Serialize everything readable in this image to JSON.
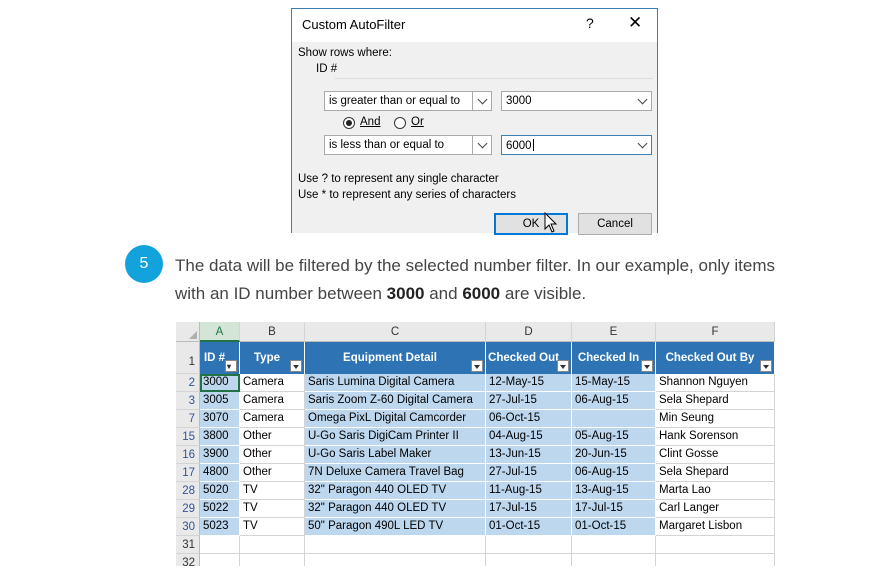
{
  "dialog": {
    "title": "Custom AutoFilter",
    "help": "?",
    "close": "✕",
    "show_rows_label": "Show rows where:",
    "field_label": "ID #",
    "cond1_operator": "is greater than or equal to",
    "cond1_value": "3000",
    "and_label": "And",
    "or_label": "Or",
    "and_selected": true,
    "cond2_operator": "is less than or equal to",
    "cond2_value": "6000",
    "hint1": "Use ? to represent any single character",
    "hint2": "Use * to represent any series of characters",
    "ok_label": "OK",
    "cancel_label": "Cancel"
  },
  "step": {
    "number": "5",
    "text_before": "The data will be filtered by the selected number filter. In our example, only items with an ID number between ",
    "bold1": "3000",
    "text_mid": " and ",
    "bold2": "6000",
    "text_after": " are visible."
  },
  "sheet": {
    "columns": [
      "A",
      "B",
      "C",
      "D",
      "E",
      "F"
    ],
    "headers": [
      "ID #",
      "Type",
      "Equipment Detail",
      "Checked Out",
      "Checked In",
      "Checked Out By"
    ],
    "header_row_number": "1",
    "rows": [
      {
        "row": "2",
        "cells": [
          "3000",
          "Camera",
          "Saris Lumina Digital Camera",
          "12-May-15",
          "15-May-15",
          "Shannon Nguyen"
        ]
      },
      {
        "row": "3",
        "cells": [
          "3005",
          "Camera",
          "Saris Zoom Z-60 Digital Camera",
          "27-Jul-15",
          "06-Aug-15",
          "Sela Shepard"
        ]
      },
      {
        "row": "7",
        "cells": [
          "3070",
          "Camera",
          "Omega PixL Digital Camcorder",
          "06-Oct-15",
          "",
          "Min Seung"
        ]
      },
      {
        "row": "15",
        "cells": [
          "3800",
          "Other",
          "U-Go Saris DigiCam Printer II",
          "04-Aug-15",
          "05-Aug-15",
          "Hank Sorenson"
        ]
      },
      {
        "row": "16",
        "cells": [
          "3900",
          "Other",
          "U-Go Saris Label Maker",
          "13-Jun-15",
          "20-Jun-15",
          "Clint Gosse"
        ]
      },
      {
        "row": "17",
        "cells": [
          "4800",
          "Other",
          "7N Deluxe Camera Travel Bag",
          "27-Jul-15",
          "06-Aug-15",
          "Sela Shepard"
        ]
      },
      {
        "row": "28",
        "cells": [
          "5020",
          "TV",
          "32\" Paragon 440 OLED TV",
          "11-Aug-15",
          "13-Aug-15",
          "Marta Lao"
        ]
      },
      {
        "row": "29",
        "cells": [
          "5022",
          "TV",
          "32\" Paragon 440 OLED TV",
          "17-Jul-15",
          "17-Jul-15",
          "Carl Langer"
        ]
      },
      {
        "row": "30",
        "cells": [
          "5023",
          "TV",
          "50\" Paragon 490L LED TV",
          "01-Oct-15",
          "01-Oct-15",
          "Margaret Lisbon"
        ]
      }
    ],
    "empty_rows": [
      "31",
      "32"
    ],
    "colors": {
      "header_bg": "#2e74b5",
      "highlight": "#bdd7ee",
      "selection": "#217346",
      "badge": "#12a2dc"
    }
  }
}
